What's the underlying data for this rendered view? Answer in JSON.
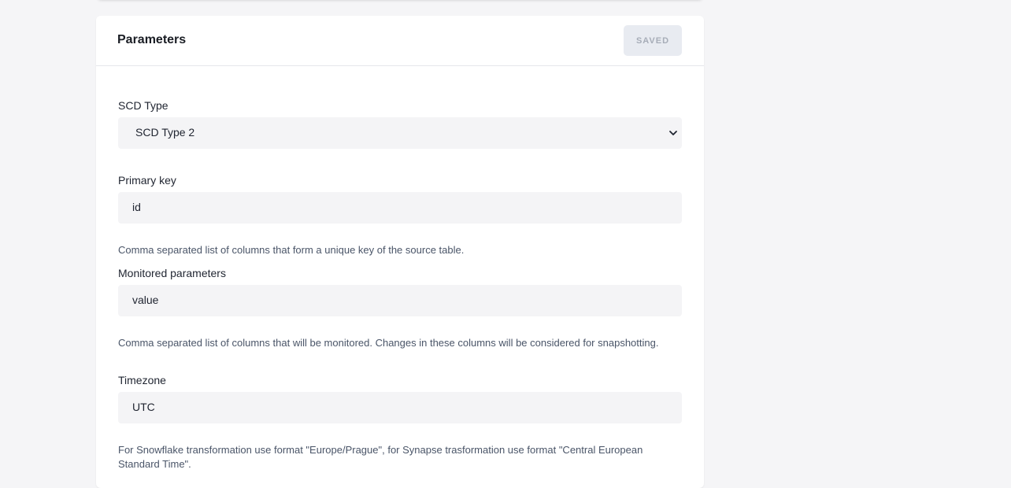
{
  "panel": {
    "title": "Parameters",
    "saved_label": "SAVED"
  },
  "fields": {
    "scd_type": {
      "label": "SCD Type",
      "selected": "SCD Type 2"
    },
    "primary_key": {
      "label": "Primary key",
      "value": "id",
      "help": "Comma separated list of columns that form a unique key of the source table."
    },
    "monitored_parameters": {
      "label": "Monitored parameters",
      "value": "value",
      "help": "Comma separated list of columns that will be monitored. Changes in these columns will be considered for snapshotting."
    },
    "timezone": {
      "label": "Timezone",
      "value": "UTC",
      "help": "For Snowflake transformation use format \"Europe/Prague\", for Synapse trasformation use format \"Central European Standard Time\"."
    }
  },
  "icons": {
    "select_chevron": "chevron-down-icon"
  }
}
